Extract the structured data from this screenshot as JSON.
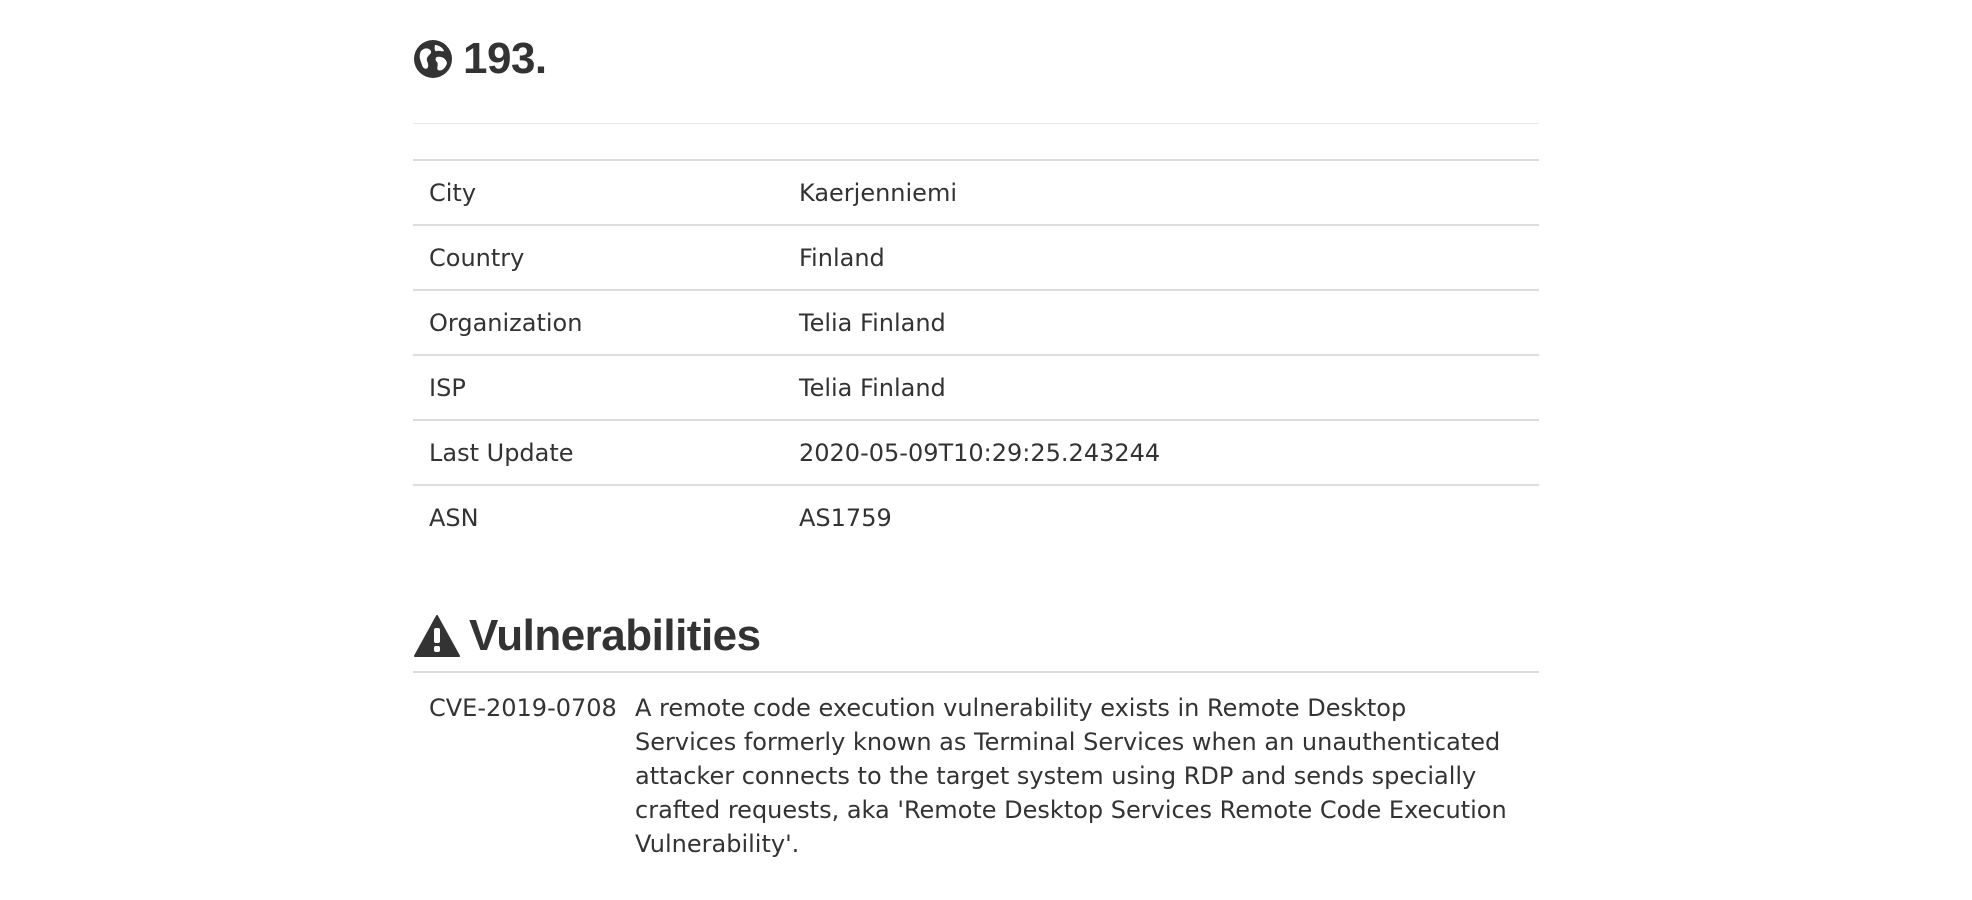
{
  "header": {
    "ip": "193.",
    "icon": "globe-icon"
  },
  "info": [
    {
      "key": "City",
      "value": "Kaerjenniemi"
    },
    {
      "key": "Country",
      "value": "Finland"
    },
    {
      "key": "Organization",
      "value": "Telia Finland"
    },
    {
      "key": "ISP",
      "value": "Telia Finland"
    },
    {
      "key": "Last Update",
      "value": "2020-05-09T10:29:25.243244"
    },
    {
      "key": "ASN",
      "value": "AS1759"
    }
  ],
  "vulnerabilities": {
    "title": "Vulnerabilities",
    "icon": "warning-icon",
    "items": [
      {
        "id": "CVE-2019-0708",
        "description": "A remote code execution vulnerability exists in Remote Desktop Services formerly known as Terminal Services when an unauthenticated attacker connects to the target system using RDP and sends specially crafted requests, aka 'Remote Desktop Services Remote Code Execution Vulnerability'."
      }
    ]
  },
  "colors": {
    "text": "#333333",
    "border": "#dddddd"
  }
}
